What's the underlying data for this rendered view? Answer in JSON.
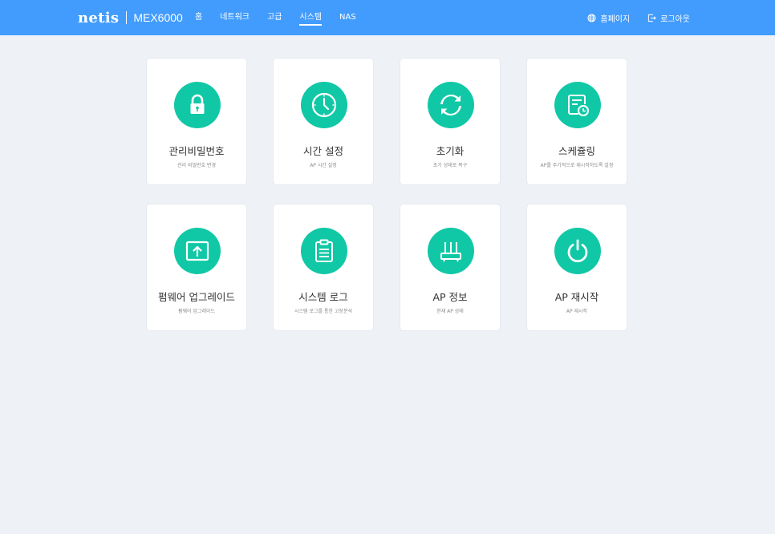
{
  "header": {
    "logo": "netis",
    "model": "MEX6000",
    "nav": [
      {
        "label": "홈",
        "active": false
      },
      {
        "label": "네트워크",
        "active": false
      },
      {
        "label": "고급",
        "active": false
      },
      {
        "label": "시스템",
        "active": true
      },
      {
        "label": "NAS",
        "active": false
      }
    ],
    "homepage_label": "홈페이지",
    "logout_label": "로그아웃"
  },
  "cards": [
    {
      "title": "관리비밀번호",
      "desc": "관리 비밀번호 변경",
      "icon": "lock-icon"
    },
    {
      "title": "시간 설정",
      "desc": "AP 시간 설정",
      "icon": "clock-icon"
    },
    {
      "title": "초기화",
      "desc": "초기 상태로 복구",
      "icon": "reset-icon"
    },
    {
      "title": "스케쥴링",
      "desc": "AP를 주기적으로 재시작하도록 설정",
      "icon": "schedule-icon"
    },
    {
      "title": "펌웨어 업그레이드",
      "desc": "펌웨어 업그레이드",
      "icon": "upload-icon"
    },
    {
      "title": "시스템 로그",
      "desc": "시스템 로그를 통한 고장분석",
      "icon": "clipboard-icon"
    },
    {
      "title": "AP 정보",
      "desc": "현재 AP 상태",
      "icon": "router-icon"
    },
    {
      "title": "AP 재시작",
      "desc": "AP 재시작",
      "icon": "power-icon"
    }
  ],
  "colors": {
    "header_bg": "#429cfd",
    "accent": "#11c8a6",
    "page_bg": "#eef1f5"
  }
}
